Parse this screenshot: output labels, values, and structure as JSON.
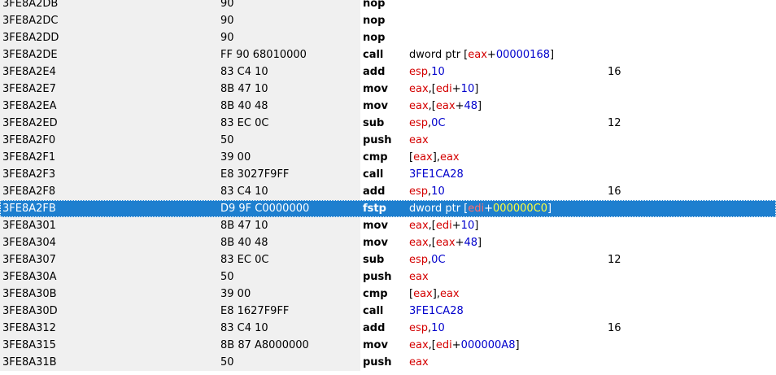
{
  "rows": [
    {
      "address": "3FE8A2DB",
      "bytes": "90",
      "mnemonic": "nop",
      "operands": [],
      "comment": ""
    },
    {
      "address": "3FE8A2DC",
      "bytes": "90",
      "mnemonic": "nop",
      "operands": [],
      "comment": ""
    },
    {
      "address": "3FE8A2DD",
      "bytes": "90",
      "mnemonic": "nop",
      "operands": [],
      "comment": ""
    },
    {
      "address": "3FE8A2DE",
      "bytes": "FF 90 68010000",
      "mnemonic": "call",
      "operands": [
        {
          "t": "dword ptr [",
          "c": "plain"
        },
        {
          "t": "eax",
          "c": "reg"
        },
        {
          "t": "+",
          "c": "plain"
        },
        {
          "t": "00000168",
          "c": "num"
        },
        {
          "t": "]",
          "c": "plain"
        }
      ],
      "comment": ""
    },
    {
      "address": "3FE8A2E4",
      "bytes": "83 C4 10",
      "mnemonic": "add",
      "operands": [
        {
          "t": "esp",
          "c": "reg"
        },
        {
          "t": ",",
          "c": "plain"
        },
        {
          "t": "10",
          "c": "num"
        }
      ],
      "comment": "16"
    },
    {
      "address": "3FE8A2E7",
      "bytes": "8B 47 10",
      "mnemonic": "mov",
      "operands": [
        {
          "t": "eax",
          "c": "reg"
        },
        {
          "t": ",[",
          "c": "plain"
        },
        {
          "t": "edi",
          "c": "reg"
        },
        {
          "t": "+",
          "c": "plain"
        },
        {
          "t": "10",
          "c": "num"
        },
        {
          "t": "]",
          "c": "plain"
        }
      ],
      "comment": ""
    },
    {
      "address": "3FE8A2EA",
      "bytes": "8B 40 48",
      "mnemonic": "mov",
      "operands": [
        {
          "t": "eax",
          "c": "reg"
        },
        {
          "t": ",[",
          "c": "plain"
        },
        {
          "t": "eax",
          "c": "reg"
        },
        {
          "t": "+",
          "c": "plain"
        },
        {
          "t": "48",
          "c": "num"
        },
        {
          "t": "]",
          "c": "plain"
        }
      ],
      "comment": ""
    },
    {
      "address": "3FE8A2ED",
      "bytes": "83 EC 0C",
      "mnemonic": "sub",
      "operands": [
        {
          "t": "esp",
          "c": "reg"
        },
        {
          "t": ",",
          "c": "plain"
        },
        {
          "t": "0C",
          "c": "num"
        }
      ],
      "comment": "12"
    },
    {
      "address": "3FE8A2F0",
      "bytes": "50",
      "mnemonic": "push",
      "operands": [
        {
          "t": "eax",
          "c": "reg"
        }
      ],
      "comment": ""
    },
    {
      "address": "3FE8A2F1",
      "bytes": "39 00",
      "mnemonic": "cmp",
      "operands": [
        {
          "t": "[",
          "c": "plain"
        },
        {
          "t": "eax",
          "c": "reg"
        },
        {
          "t": "],",
          "c": "plain"
        },
        {
          "t": "eax",
          "c": "reg"
        }
      ],
      "comment": ""
    },
    {
      "address": "3FE8A2F3",
      "bytes": "E8 3027F9FF",
      "mnemonic": "call",
      "operands": [
        {
          "t": "3FE1CA28",
          "c": "num"
        }
      ],
      "comment": ""
    },
    {
      "address": "3FE8A2F8",
      "bytes": "83 C4 10",
      "mnemonic": "add",
      "operands": [
        {
          "t": "esp",
          "c": "reg"
        },
        {
          "t": ",",
          "c": "plain"
        },
        {
          "t": "10",
          "c": "num"
        }
      ],
      "comment": "16"
    },
    {
      "address": "3FE8A2FB",
      "bytes": "D9 9F C0000000",
      "mnemonic": "fstp",
      "operands": [
        {
          "t": "dword ptr [",
          "c": "plain"
        },
        {
          "t": "edi",
          "c": "reg"
        },
        {
          "t": "+",
          "c": "plain"
        },
        {
          "t": "000000C0",
          "c": "num"
        },
        {
          "t": "]",
          "c": "plain"
        }
      ],
      "comment": "",
      "selected": true
    },
    {
      "address": "3FE8A301",
      "bytes": "8B 47 10",
      "mnemonic": "mov",
      "operands": [
        {
          "t": "eax",
          "c": "reg"
        },
        {
          "t": ",[",
          "c": "plain"
        },
        {
          "t": "edi",
          "c": "reg"
        },
        {
          "t": "+",
          "c": "plain"
        },
        {
          "t": "10",
          "c": "num"
        },
        {
          "t": "]",
          "c": "plain"
        }
      ],
      "comment": ""
    },
    {
      "address": "3FE8A304",
      "bytes": "8B 40 48",
      "mnemonic": "mov",
      "operands": [
        {
          "t": "eax",
          "c": "reg"
        },
        {
          "t": ",[",
          "c": "plain"
        },
        {
          "t": "eax",
          "c": "reg"
        },
        {
          "t": "+",
          "c": "plain"
        },
        {
          "t": "48",
          "c": "num"
        },
        {
          "t": "]",
          "c": "plain"
        }
      ],
      "comment": ""
    },
    {
      "address": "3FE8A307",
      "bytes": "83 EC 0C",
      "mnemonic": "sub",
      "operands": [
        {
          "t": "esp",
          "c": "reg"
        },
        {
          "t": ",",
          "c": "plain"
        },
        {
          "t": "0C",
          "c": "num"
        }
      ],
      "comment": "12"
    },
    {
      "address": "3FE8A30A",
      "bytes": "50",
      "mnemonic": "push",
      "operands": [
        {
          "t": "eax",
          "c": "reg"
        }
      ],
      "comment": ""
    },
    {
      "address": "3FE8A30B",
      "bytes": "39 00",
      "mnemonic": "cmp",
      "operands": [
        {
          "t": "[",
          "c": "plain"
        },
        {
          "t": "eax",
          "c": "reg"
        },
        {
          "t": "],",
          "c": "plain"
        },
        {
          "t": "eax",
          "c": "reg"
        }
      ],
      "comment": ""
    },
    {
      "address": "3FE8A30D",
      "bytes": "E8 1627F9FF",
      "mnemonic": "call",
      "operands": [
        {
          "t": "3FE1CA28",
          "c": "num"
        }
      ],
      "comment": ""
    },
    {
      "address": "3FE8A312",
      "bytes": "83 C4 10",
      "mnemonic": "add",
      "operands": [
        {
          "t": "esp",
          "c": "reg"
        },
        {
          "t": ",",
          "c": "plain"
        },
        {
          "t": "10",
          "c": "num"
        }
      ],
      "comment": "16"
    },
    {
      "address": "3FE8A315",
      "bytes": "8B 87 A8000000",
      "mnemonic": "mov",
      "operands": [
        {
          "t": "eax",
          "c": "reg"
        },
        {
          "t": ",[",
          "c": "plain"
        },
        {
          "t": "edi",
          "c": "reg"
        },
        {
          "t": "+",
          "c": "plain"
        },
        {
          "t": "000000A8",
          "c": "num"
        },
        {
          "t": "]",
          "c": "plain"
        }
      ],
      "comment": ""
    },
    {
      "address": "3FE8A31B",
      "bytes": "50",
      "mnemonic": "push",
      "operands": [
        {
          "t": "eax",
          "c": "reg"
        }
      ],
      "comment": ""
    }
  ],
  "colors": {
    "register": "#d40000",
    "number": "#0000cc",
    "selection": "#1e7fcf",
    "selected_register": "#ff6b6b",
    "selected_number": "#ffff3a"
  }
}
